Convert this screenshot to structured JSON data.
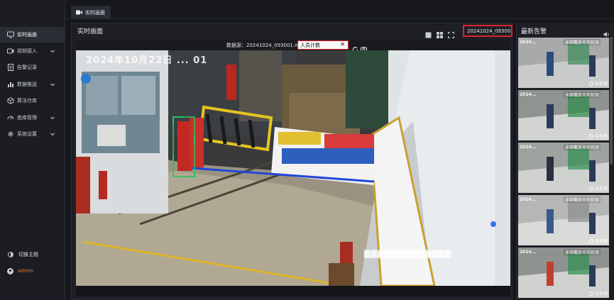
{
  "sidebar": {
    "items": [
      {
        "label": "实时画面",
        "icon": "monitor-icon",
        "active": true,
        "has_children": false
      },
      {
        "label": "视频接入",
        "icon": "camera-icon",
        "active": false,
        "has_children": true
      },
      {
        "label": "告警记录",
        "icon": "document-icon",
        "active": false,
        "has_children": false
      },
      {
        "label": "数据推送",
        "icon": "bar-chart-icon",
        "active": false,
        "has_children": true
      },
      {
        "label": "算法仓库",
        "icon": "cube-icon",
        "active": false,
        "has_children": false
      },
      {
        "label": "底库管理",
        "icon": "gauge-icon",
        "active": false,
        "has_children": true
      },
      {
        "label": "系统设置",
        "icon": "gear-icon",
        "active": false,
        "has_children": true
      }
    ],
    "theme_label": "切换主题",
    "user": "admin"
  },
  "tabs": [
    {
      "label": "实时画面",
      "icon": "video-icon"
    }
  ],
  "main": {
    "title": "实时画面",
    "source_selector": "20241024_09300...",
    "view_icons": [
      "single-view-icon",
      "grid-view-icon",
      "fullscreen-icon"
    ]
  },
  "video": {
    "source_label": "数据源：20241024_093001.mp4",
    "algorithm": "人员计数",
    "overlay_timestamp": "2024年10月22日 ... 01",
    "blurred_text": "▇▇▇▇▇▇▇▇▇▇▇▇▇"
  },
  "alarms": {
    "title": "最新告警",
    "items": [
      {
        "timestamp": "2024...",
        "type": "未穿戴反光衣检测",
        "status": "未处理"
      },
      {
        "timestamp": "2024...",
        "type": "未穿戴反光衣检测",
        "status": "未处理"
      },
      {
        "timestamp": "2024...",
        "type": "未穿戴反光衣检测",
        "status": "未处理"
      },
      {
        "timestamp": "2024...",
        "type": "未穿戴反光衣检测",
        "status": "未处理"
      },
      {
        "timestamp": "2024...",
        "type": "未穿戴反光衣检测",
        "status": "未处理"
      }
    ]
  },
  "colors": {
    "highlight_border": "#e0232a",
    "background": "#15171c",
    "panel": "#1d1f25",
    "detection_box": "#22c55e"
  }
}
